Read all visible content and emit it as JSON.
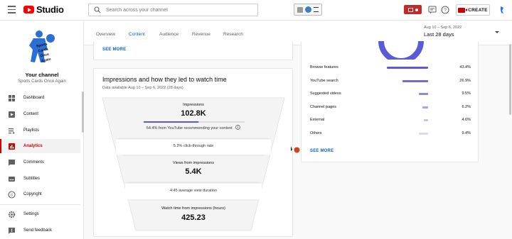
{
  "app": {
    "name": "Studio"
  },
  "search": {
    "placeholder": "Search across your channel"
  },
  "header": {
    "create_label": "CREATE"
  },
  "channel": {
    "title": "Your channel",
    "name": "Sports Cards Once Again"
  },
  "sidebar": {
    "items": [
      {
        "label": "Dashboard",
        "icon": "dashboard-icon",
        "active": false
      },
      {
        "label": "Content",
        "icon": "content-icon",
        "active": false
      },
      {
        "label": "Playlists",
        "icon": "playlists-icon",
        "active": false
      },
      {
        "label": "Analytics",
        "icon": "analytics-icon",
        "active": true
      },
      {
        "label": "Comments",
        "icon": "comments-icon",
        "active": false
      },
      {
        "label": "Subtitles",
        "icon": "subtitles-icon",
        "active": false
      },
      {
        "label": "Copyright",
        "icon": "copyright-icon",
        "active": false
      },
      {
        "label": "Settings",
        "icon": "settings-icon",
        "active": false
      },
      {
        "label": "Send feedback",
        "icon": "feedback-icon",
        "active": false
      }
    ]
  },
  "tabs": [
    {
      "label": "Overview",
      "active": false
    },
    {
      "label": "Content",
      "active": true
    },
    {
      "label": "Audience",
      "active": false
    },
    {
      "label": "Revenue",
      "active": false
    },
    {
      "label": "Research",
      "active": false
    }
  ],
  "date_selector": {
    "range": "Aug 10 – Sep 6, 2022",
    "label": "Last 28 days"
  },
  "top_card": {
    "see_more": "SEE MORE"
  },
  "funnel": {
    "title": "Impressions and how they led to watch time",
    "subtitle": "Data available Aug 10 – Sep 6, 2022 (28 days)",
    "impressions_label": "Impressions",
    "impressions_value": "102.8K",
    "recommend_fraction": 0.544,
    "recommend_note": "54.4% from YouTube recommending your content",
    "ctr_note": "5.2% click-through rate",
    "views_label": "Views from impressions",
    "views_value": "5.4K",
    "avd_note": "4:45 average view duration",
    "watch_label": "Watch time from impressions (hours)",
    "watch_value": "425.23"
  },
  "traffic_sources": {
    "see_more": "SEE MORE",
    "colors": [
      "#5b5bd6",
      "#6d6dd8",
      "#8a8ae0",
      "#a5a5ea",
      "#c3c3f1",
      "#dadaf5"
    ],
    "rows": [
      {
        "label": "Browse features",
        "pct_text": "43.4%",
        "value": 43.4
      },
      {
        "label": "YouTube search",
        "pct_text": "26.9%",
        "value": 26.9
      },
      {
        "label": "Suggested videos",
        "pct_text": "9.5%",
        "value": 9.5
      },
      {
        "label": "Channel pages",
        "pct_text": "6.2%",
        "value": 6.2
      },
      {
        "label": "External",
        "pct_text": "4.6%",
        "value": 4.6
      },
      {
        "label": "Others",
        "pct_text": "9.4%",
        "value": 9.4
      }
    ]
  }
}
